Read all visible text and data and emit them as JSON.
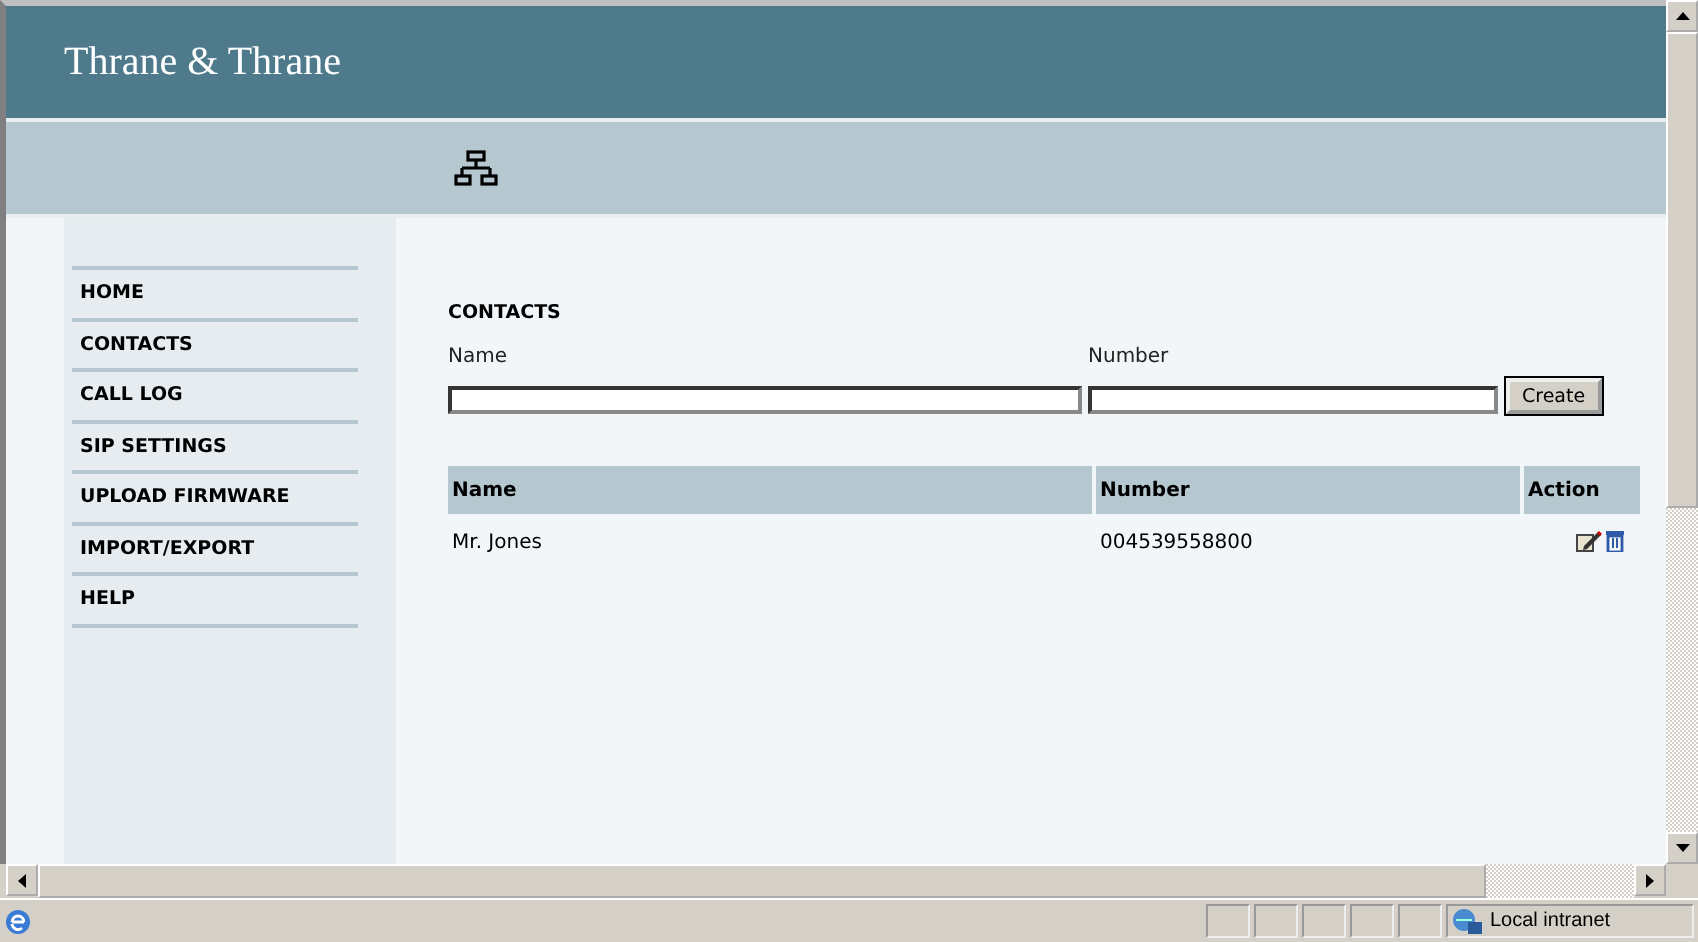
{
  "header": {
    "logo": "Thrane & Thrane"
  },
  "sidebar": {
    "items": [
      {
        "label": "HOME"
      },
      {
        "label": "CONTACTS"
      },
      {
        "label": "CALL LOG"
      },
      {
        "label": "SIP SETTINGS"
      },
      {
        "label": "UPLOAD FIRMWARE"
      },
      {
        "label": "IMPORT/EXPORT"
      },
      {
        "label": "HELP"
      }
    ]
  },
  "section_title": "CONTACTS",
  "form": {
    "fields": [
      {
        "label": "Name"
      },
      {
        "label": "Number"
      }
    ],
    "button": "Create"
  },
  "table": {
    "columns": [
      "Name",
      "Number",
      "Action"
    ],
    "rows": [
      {
        "name": "Mr. Jones",
        "number": "004539558800"
      }
    ]
  },
  "status_bar": {
    "zone": "Local intranet"
  }
}
